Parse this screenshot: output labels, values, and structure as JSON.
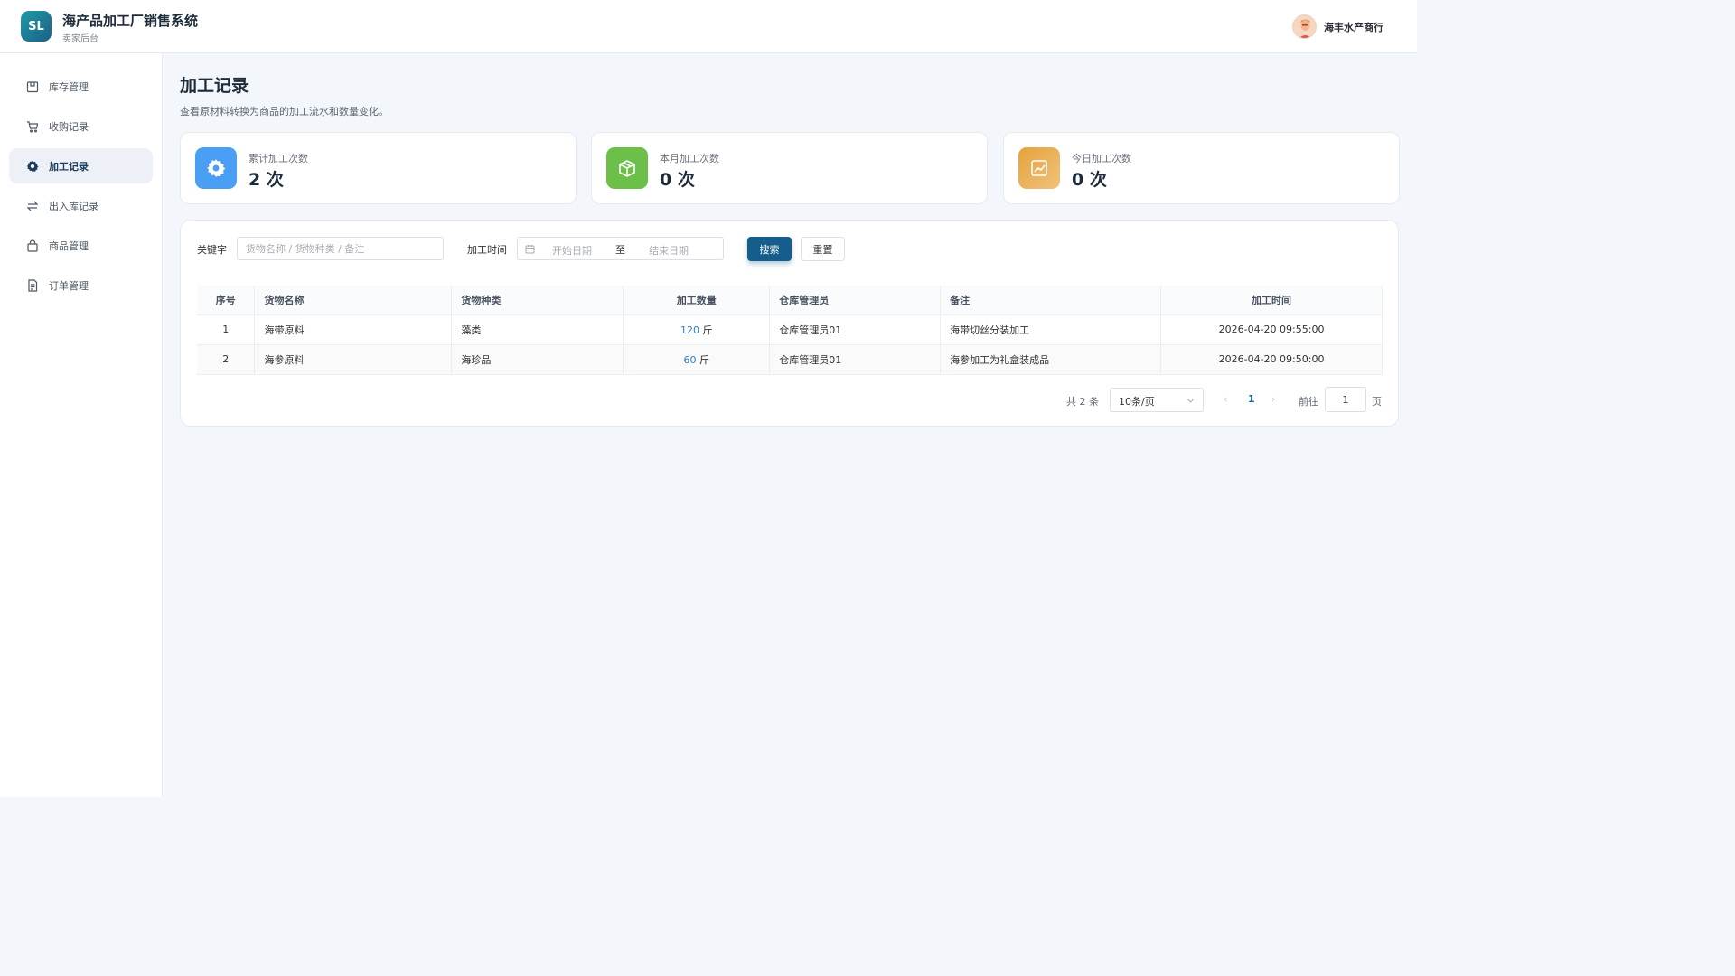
{
  "header": {
    "logo_text": "SL",
    "title": "海产品加工厂销售系统",
    "subtitle": "卖家后台",
    "user_name": "海丰水产商行"
  },
  "sidebar": {
    "items": [
      {
        "label": "库存管理",
        "icon": "inventory-icon"
      },
      {
        "label": "收购记录",
        "icon": "cart-icon"
      },
      {
        "label": "加工记录",
        "icon": "gear-icon",
        "active": true
      },
      {
        "label": "出入库记录",
        "icon": "transfer-icon"
      },
      {
        "label": "商品管理",
        "icon": "bag-icon"
      },
      {
        "label": "订单管理",
        "icon": "document-icon"
      }
    ]
  },
  "page": {
    "title": "加工记录",
    "description": "查看原材料转换为商品的加工流水和数量变化。"
  },
  "stats": [
    {
      "label": "累计加工次数",
      "value": "2 次",
      "icon": "gear-icon",
      "color": "#4a9ff5"
    },
    {
      "label": "本月加工次数",
      "value": "0 次",
      "icon": "box-icon",
      "color": "#6cc04a"
    },
    {
      "label": "今日加工次数",
      "value": "0 次",
      "icon": "trend-chart-icon",
      "color": "#e6a23c"
    }
  ],
  "filters": {
    "keyword_label": "关键字",
    "keyword_placeholder": "货物名称 / 货物种类 / 备注",
    "time_label": "加工时间",
    "start_placeholder": "开始日期",
    "range_separator": "至",
    "end_placeholder": "结束日期",
    "search_button": "搜索",
    "reset_button": "重置"
  },
  "table": {
    "columns": [
      "序号",
      "货物名称",
      "货物种类",
      "加工数量",
      "仓库管理员",
      "备注",
      "加工时间"
    ],
    "rows": [
      {
        "index": "1",
        "name": "海带原料",
        "category": "藻类",
        "qty": "120",
        "unit": "斤",
        "manager": "仓库管理员01",
        "remark": "海带切丝分装加工",
        "time": "2026-04-20 09:55:00"
      },
      {
        "index": "2",
        "name": "海参原料",
        "category": "海珍品",
        "qty": "60",
        "unit": "斤",
        "manager": "仓库管理员01",
        "remark": "海参加工为礼盒装成品",
        "time": "2026-04-20 09:50:00"
      }
    ]
  },
  "pagination": {
    "total_text": "共 2 条",
    "page_size": "10条/页",
    "prev": "‹",
    "current_page": "1",
    "next": "›",
    "goto_label": "前往",
    "goto_value": "1",
    "page_suffix": "页"
  }
}
